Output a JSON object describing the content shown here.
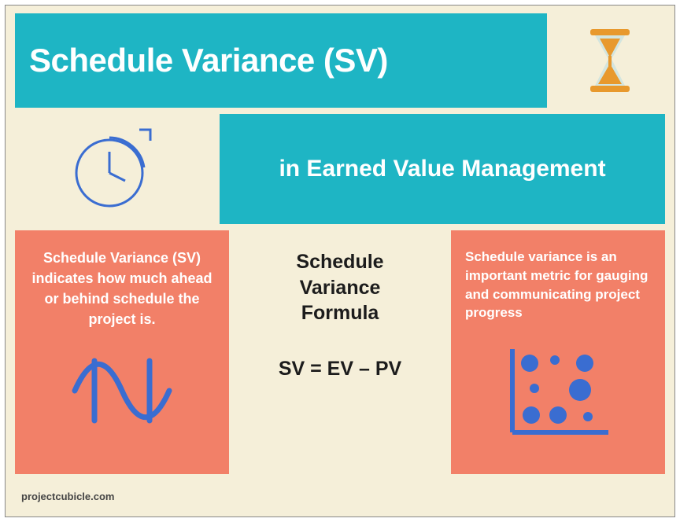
{
  "header": {
    "title": "Schedule Variance (SV)",
    "hourglass_icon": "hourglass-icon"
  },
  "row2": {
    "clock_icon": "clock-arrow-icon",
    "subtitle": "in Earned Value Management"
  },
  "columns": {
    "left": {
      "text": "Schedule Variance (SV) indicates how much ahead or behind schedule the project is.",
      "icon": "wave-icon"
    },
    "middle": {
      "heading_line1": "Schedule",
      "heading_line2": "Variance",
      "heading_line3": "Formula",
      "equation": "SV = EV – PV"
    },
    "right": {
      "text": "Schedule variance is an important metric for gauging and communicating project progress",
      "icon": "scatter-plot-icon"
    }
  },
  "footer": {
    "credit": "projectcubicle.com"
  },
  "colors": {
    "teal": "#1eb5c4",
    "cream": "#f5efd9",
    "salmon": "#f28068",
    "blue_accent": "#3a6dd1",
    "orange_accent": "#e8992d"
  }
}
